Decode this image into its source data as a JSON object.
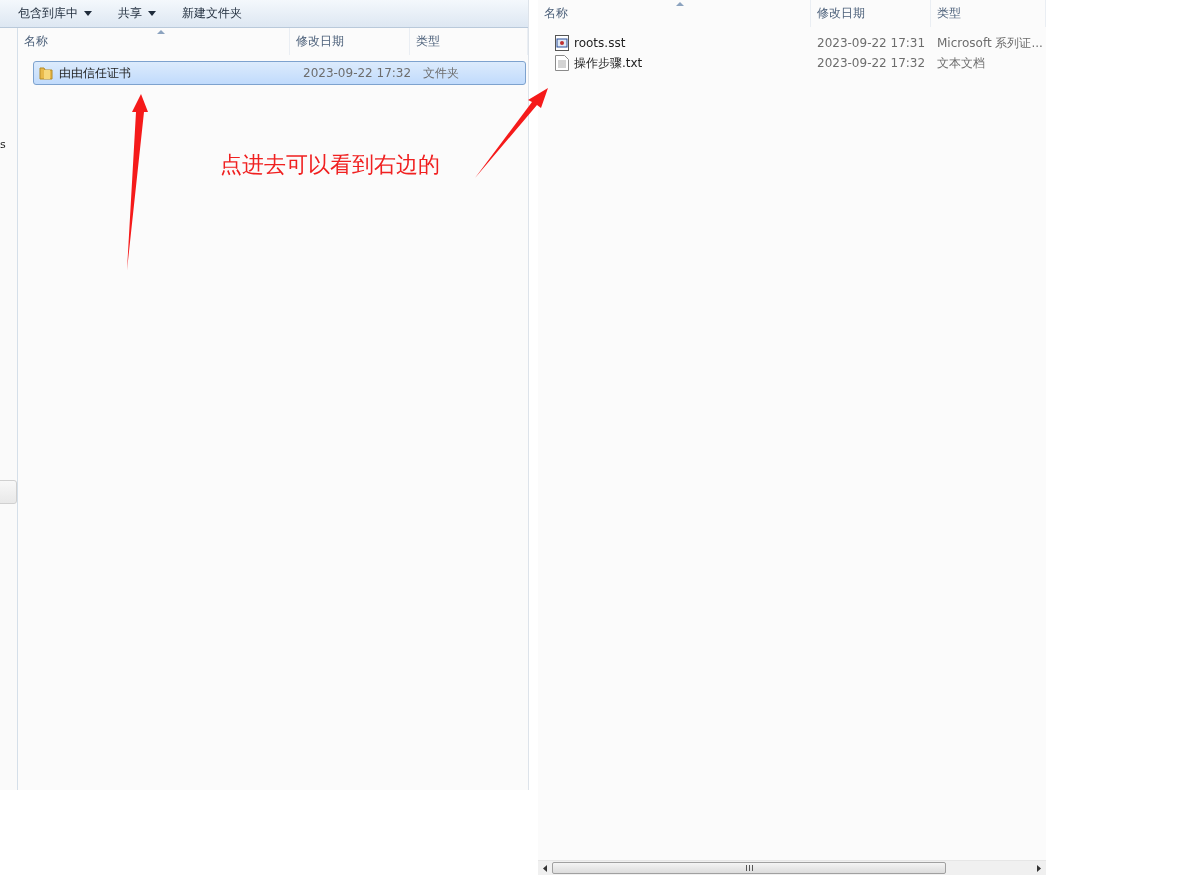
{
  "left_window": {
    "toolbar": [
      {
        "label": "包含到库中",
        "dropdown": true
      },
      {
        "label": "共享",
        "dropdown": true
      },
      {
        "label": "新建文件夹",
        "dropdown": false
      }
    ],
    "sidebar_fragment": "s",
    "columns": [
      "名称",
      "修改日期",
      "类型"
    ],
    "rows": [
      {
        "name": "由由信任证书",
        "date": "2023-09-22 17:32",
        "type": "文件夹",
        "kind": "folder",
        "selected": true
      }
    ]
  },
  "annotation": "点进去可以看到右边的",
  "right_window": {
    "columns": [
      "名称",
      "修改日期",
      "类型"
    ],
    "rows": [
      {
        "name": "roots.sst",
        "date": "2023-09-22 17:31",
        "type": "Microsoft 系列证...",
        "kind": "certificate",
        "selected": false
      },
      {
        "name": "操作步骤.txt",
        "date": "2023-09-22 17:32",
        "type": "文本文档",
        "kind": "text",
        "selected": false
      }
    ]
  }
}
